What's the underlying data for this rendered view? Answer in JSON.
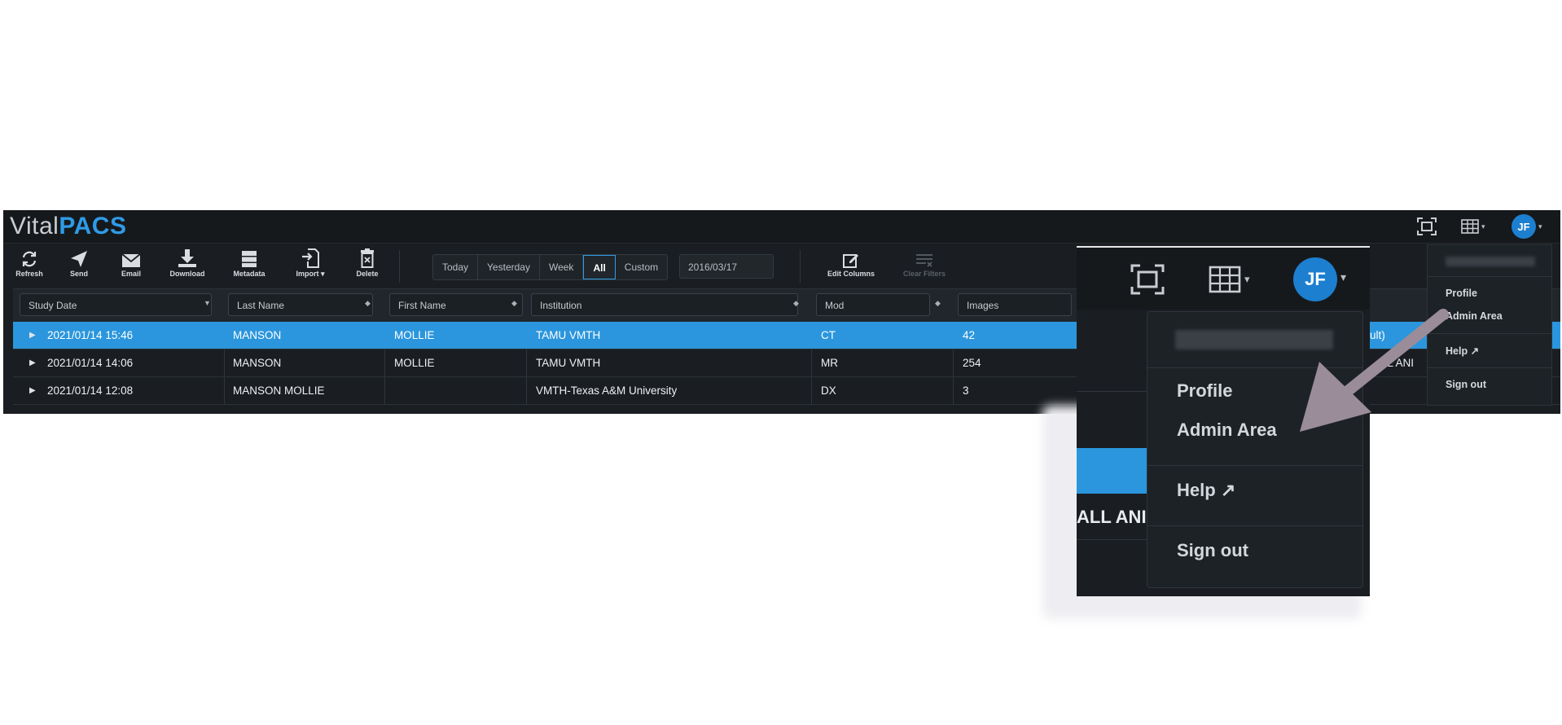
{
  "app": {
    "logo_light": "Vital",
    "logo_bold": "PACS",
    "avatar_initials": "JF"
  },
  "toolbar": {
    "refresh": "Refresh",
    "send": "Send",
    "email": "Email",
    "download": "Download",
    "metadata": "Metadata",
    "import": "Import",
    "delete": "Delete",
    "edit_columns": "Edit Columns",
    "clear_filters": "Clear Filters"
  },
  "date_range": {
    "options": [
      "Today",
      "Yesterday",
      "Week",
      "All",
      "Custom"
    ],
    "selected": "All",
    "date_value": "2016/03/17"
  },
  "columns": [
    "Study Date",
    "Last Name",
    "First Name",
    "Institution",
    "Mod",
    "Images"
  ],
  "rows": [
    {
      "date": "2021/01/14 15:46",
      "last": "MANSON",
      "first": "MOLLIE",
      "institution": "TAMU VMTH",
      "mod": "CT",
      "images": "42"
    },
    {
      "date": "2021/01/14 14:06",
      "last": "MANSON",
      "first": "MOLLIE",
      "institution": "TAMU VMTH",
      "mod": "MR",
      "images": "254"
    },
    {
      "date": "2021/01/14 12:08",
      "last": "MANSON MOLLIE",
      "first": "",
      "institution": "VMTH-Texas A&M University",
      "mod": "DX",
      "images": "3"
    }
  ],
  "user_menu": {
    "profile": "Profile",
    "admin": "Admin Area",
    "help": "Help",
    "signout": "Sign out"
  },
  "partial_text": {
    "right_cell_small": "ult)",
    "right_cell_small_2": "LL ANI",
    "zoom_row": "ALL ANI"
  },
  "colors": {
    "accent": "#2f9be6",
    "selected_row": "#2b96dd",
    "background": "#1a1e22",
    "arrow": "#9a8c98"
  }
}
